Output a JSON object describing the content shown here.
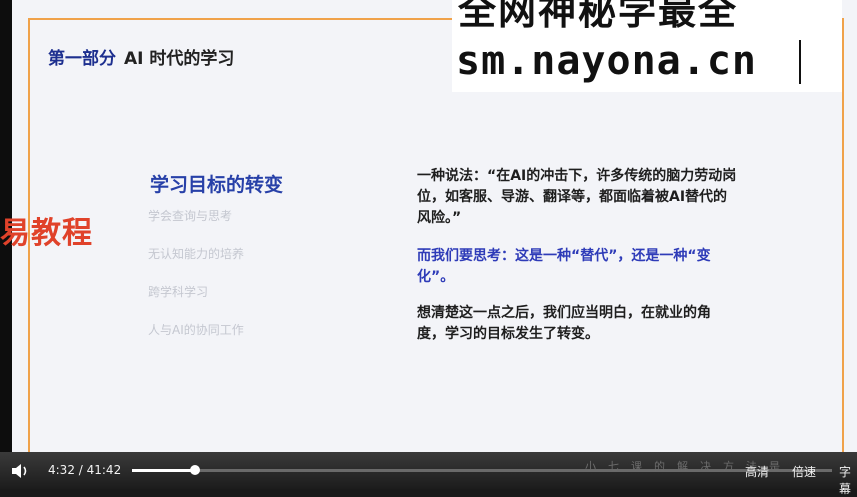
{
  "slide": {
    "section": "第一部分",
    "section_sub": "AI 时代的学习",
    "topic_title": "学习目标的转变",
    "topic_items": [
      "学会查询与思考",
      "无认知能力的培养",
      "跨学科学习",
      "人与AI的协同工作"
    ],
    "quote": "一种说法：“在AI的冲击下，许多传统的脑力劳动岗位，如客服、导游、翻译等，都面临着被AI替代的风险。”",
    "think": "而我们要思考：这是一种“替代”，还是一种“变化”。",
    "conclusion": "想清楚这一点之后，我们应当明白，在就业的角度，学习的目标发生了转变。"
  },
  "watermark": {
    "line1": "全网神秘学最全",
    "line2": "sm.nayona.cn",
    "side": "易教程"
  },
  "player": {
    "time": "4:32 / 41:42",
    "progress": 0.09,
    "faded_caption": "小七课的解决方法是",
    "quality": "高清",
    "speed": "倍速",
    "subtitle": "字幕"
  }
}
